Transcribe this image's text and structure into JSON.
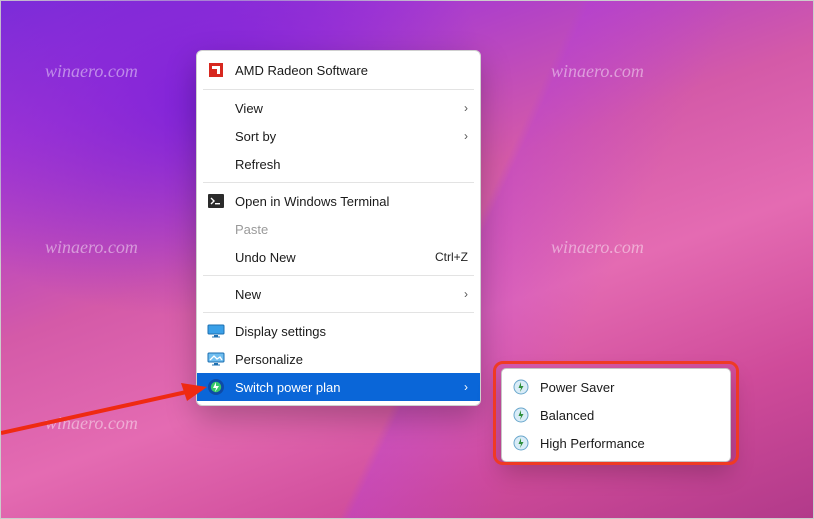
{
  "watermark": "winaero.com",
  "menu": {
    "amd": "AMD Radeon Software",
    "view": "View",
    "sort_by": "Sort by",
    "refresh": "Refresh",
    "open_terminal": "Open in Windows Terminal",
    "paste": "Paste",
    "undo_new": "Undo New",
    "undo_new_accel": "Ctrl+Z",
    "new": "New",
    "display_settings": "Display settings",
    "personalize": "Personalize",
    "switch_power_plan": "Switch power plan"
  },
  "submenu": {
    "items": [
      {
        "label": "Power Saver"
      },
      {
        "label": "Balanced"
      },
      {
        "label": "High Performance"
      }
    ]
  }
}
